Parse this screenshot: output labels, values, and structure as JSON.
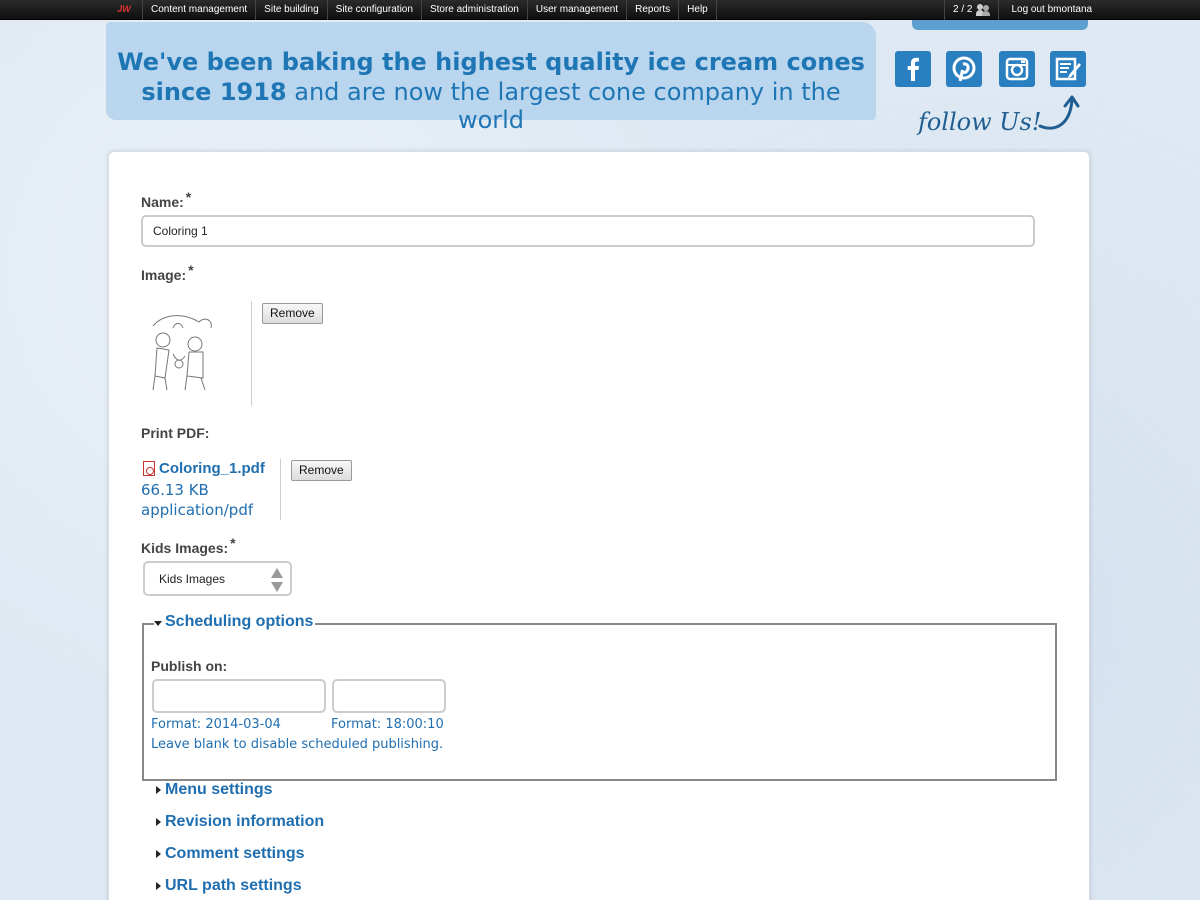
{
  "admin_bar": {
    "home_label": "JW",
    "menu": [
      "Content management",
      "Site building",
      "Site configuration",
      "Store administration",
      "User management",
      "Reports",
      "Help"
    ],
    "user_count": "2 / 2",
    "logout": "Log out bmontana"
  },
  "banner": {
    "line1": "We've been baking the highest quality ice cream cones",
    "line2_bold": "since 1918",
    "line2_rest": " and are now the largest cone company in the world"
  },
  "social": {
    "icons": [
      "facebook-icon",
      "pinterest-icon",
      "instagram-icon",
      "blog-icon"
    ],
    "follow_text": "follow Us!"
  },
  "form": {
    "name_label": "Name:",
    "required_mark": "*",
    "name_value": "Coloring 1",
    "image_label": "Image:",
    "remove_label": "Remove",
    "pdf_label": "Print PDF:",
    "pdf_file": "Coloring_1.pdf",
    "pdf_size": "66.13 KB",
    "pdf_mime": "application/pdf",
    "kids_label": "Kids Images:",
    "kids_value": "Kids Images"
  },
  "scheduling": {
    "title": "Scheduling options",
    "publish_label": "Publish on:",
    "date_value": "",
    "time_value": "",
    "date_format": "Format: 2014-03-04",
    "time_format": "Format: 18:00:10",
    "help": "Leave blank to disable scheduled publishing."
  },
  "sections": [
    "Menu settings",
    "Revision information",
    "Comment settings",
    "URL path settings"
  ],
  "colors": {
    "link_blue": "#1f6eb0",
    "banner_blue": "#b9d6ee",
    "social_blue": "#2a7fc1"
  }
}
